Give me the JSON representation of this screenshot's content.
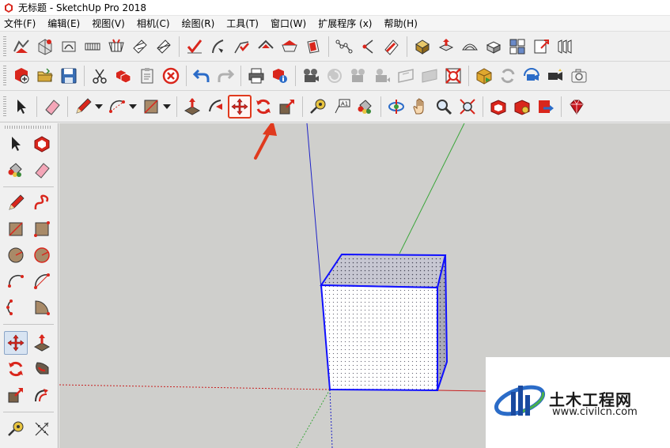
{
  "window": {
    "title": "无标题 - SketchUp Pro 2018"
  },
  "menu": {
    "items": [
      "文件(F)",
      "编辑(E)",
      "视图(V)",
      "相机(C)",
      "绘图(R)",
      "工具(T)",
      "窗口(W)",
      "扩展程序 (x)",
      "帮助(H)"
    ]
  },
  "toolbar": {
    "highlighted_tool": "move-tool",
    "highlight_color": "#e03a1e"
  },
  "colors": {
    "accent_red": "#d9261c",
    "axis_blue": "#1e22c8",
    "axis_green": "#3aa63a",
    "axis_red": "#c82020",
    "viewport_bg": "#cfcfcc",
    "selection_blue": "#1010ff"
  },
  "watermark": {
    "brand": "土木工程网",
    "url": "www.civilcn.com"
  }
}
